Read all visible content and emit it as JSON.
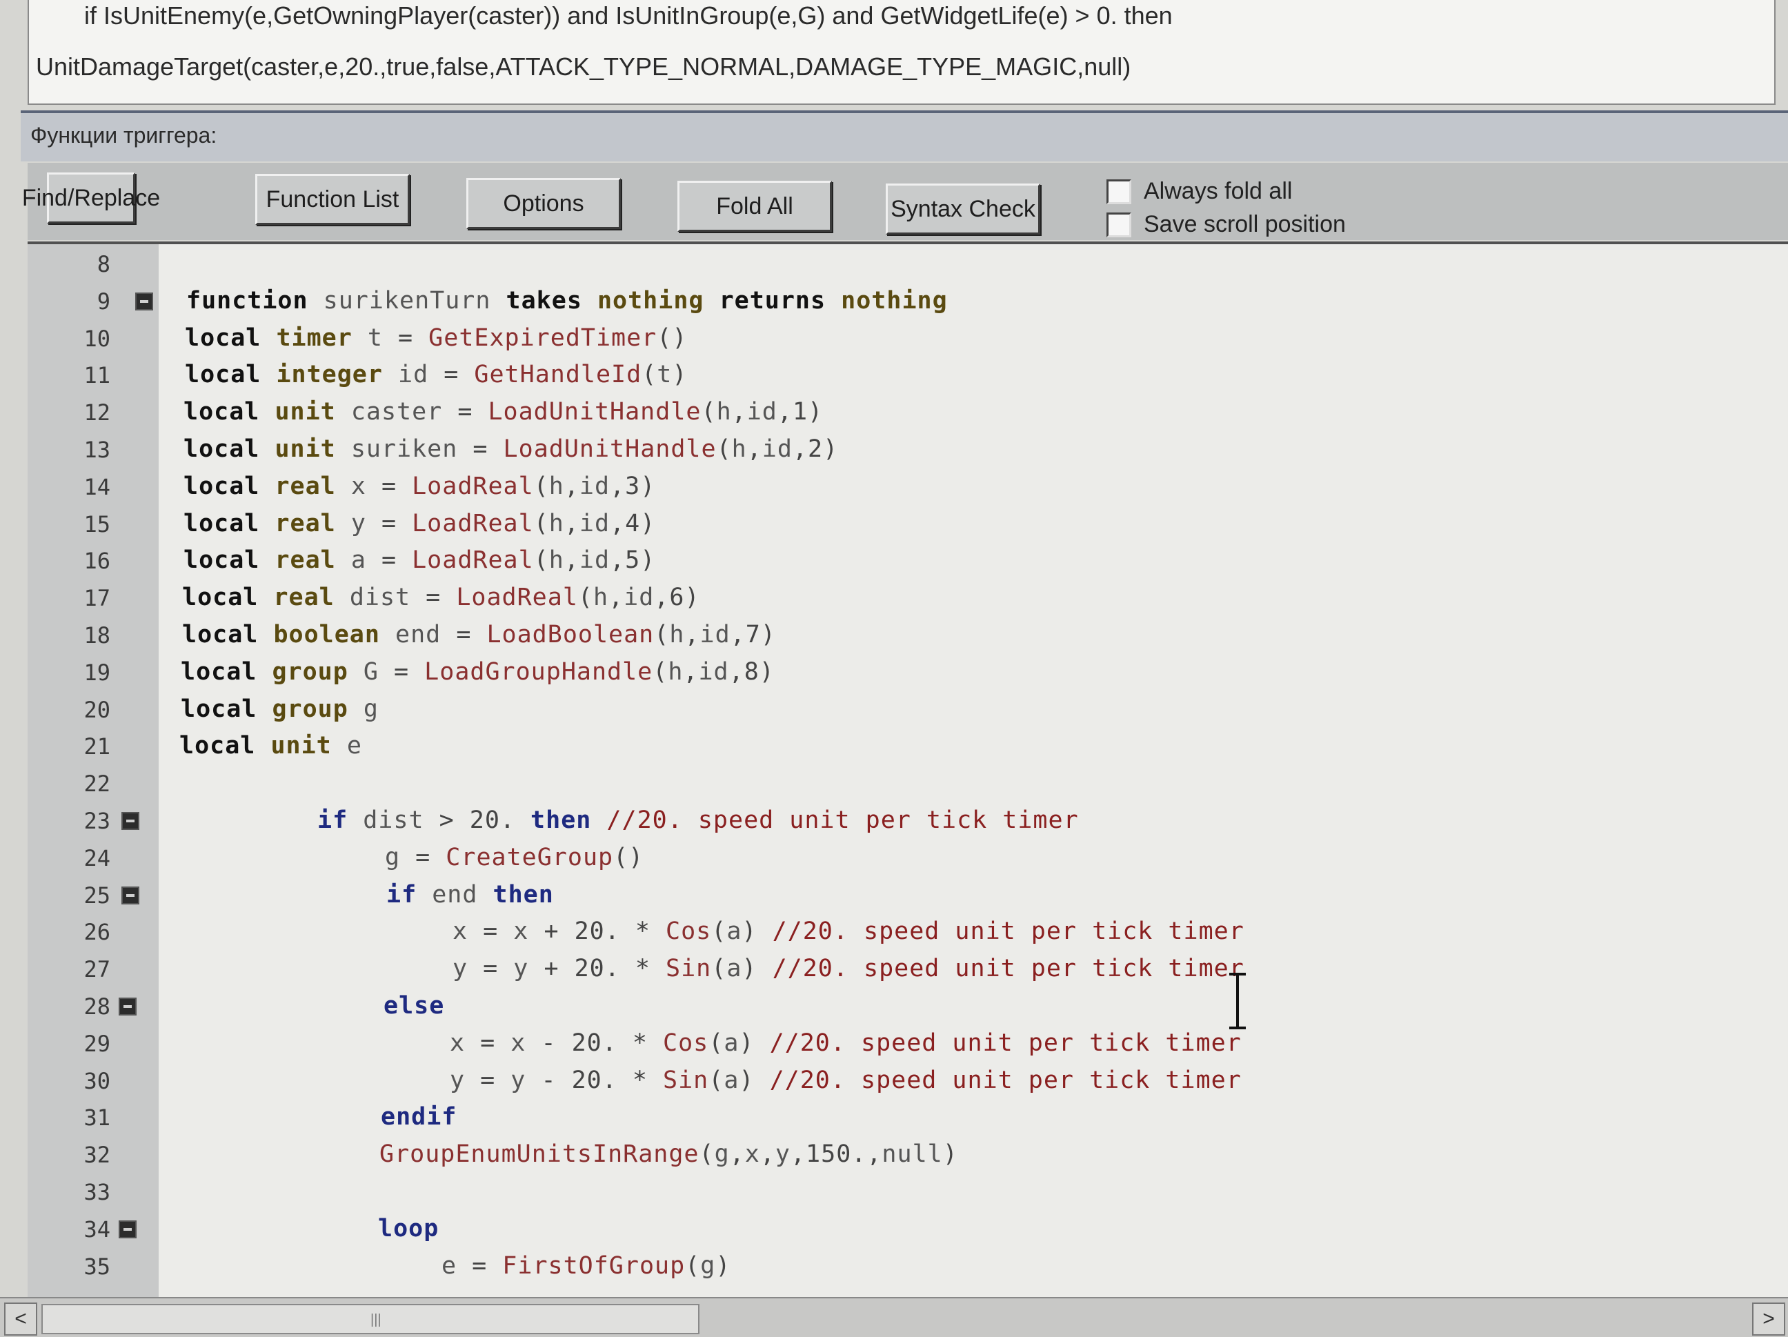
{
  "preview": {
    "line1": "if IsUnitEnemy(e,GetOwningPlayer(caster)) and IsUnitInGroup(e,G) and GetWidgetLife(e) > 0. then",
    "line2": "UnitDamageTarget(caster,e,20.,true,false,ATTACK_TYPE_NORMAL,DAMAGE_TYPE_MAGIC,null)"
  },
  "section": {
    "label": "Функции триггера:"
  },
  "toolbar": {
    "find_replace": "Find/Replace",
    "function_list": "Function List",
    "options": "Options",
    "fold_all": "Fold All",
    "syntax_check": "Syntax Check",
    "always_fold_all": "Always fold all",
    "save_scroll_position": "Save scroll position"
  },
  "editor": {
    "lines": [
      {
        "n": "8",
        "text": ""
      },
      {
        "n": "9",
        "text": "function surikenTurn takes nothing returns nothing",
        "fold": true
      },
      {
        "n": "10",
        "text": "local timer t = GetExpiredTimer()"
      },
      {
        "n": "11",
        "text": "local integer id = GetHandleId(t)"
      },
      {
        "n": "12",
        "text": "local unit caster = LoadUnitHandle(h,id,1)"
      },
      {
        "n": "13",
        "text": "local unit suriken = LoadUnitHandle(h,id,2)"
      },
      {
        "n": "14",
        "text": "local real x = LoadReal(h,id,3)"
      },
      {
        "n": "15",
        "text": "local real y = LoadReal(h,id,4)"
      },
      {
        "n": "16",
        "text": "local real a = LoadReal(h,id,5)"
      },
      {
        "n": "17",
        "text": "local real dist = LoadReal(h,id,6)"
      },
      {
        "n": "18",
        "text": "local boolean end = LoadBoolean(h,id,7)"
      },
      {
        "n": "19",
        "text": "local group G = LoadGroupHandle(h,id,8)"
      },
      {
        "n": "20",
        "text": "local group g"
      },
      {
        "n": "21",
        "text": "local unit e"
      },
      {
        "n": "22",
        "text": ""
      },
      {
        "n": "23",
        "text": "if dist > 20. then //20. speed unit per tick timer",
        "fold": true
      },
      {
        "n": "24",
        "text": "g = CreateGroup()"
      },
      {
        "n": "25",
        "text": "if end then",
        "fold": true
      },
      {
        "n": "26",
        "text": "x = x + 20. * Cos(a) //20. speed unit per tick timer"
      },
      {
        "n": "27",
        "text": "y = y + 20. * Sin(a) //20. speed unit per tick timer"
      },
      {
        "n": "28",
        "text": "else",
        "fold": true
      },
      {
        "n": "29",
        "text": "x = x - 20. * Cos(a) //20. speed unit per tick timer"
      },
      {
        "n": "30",
        "text": "y = y - 20. * Sin(a) //20. speed unit per tick timer"
      },
      {
        "n": "31",
        "text": "endif"
      },
      {
        "n": "32",
        "text": "GroupEnumUnitsInRange(g,x,y,150.,null)"
      },
      {
        "n": "33",
        "text": ""
      },
      {
        "n": "34",
        "text": "loop",
        "fold": true
      },
      {
        "n": "35",
        "text": "e = FirstOfGroup(g)"
      }
    ]
  },
  "scrollbar": {
    "left_arrow": "<",
    "right_arrow": ">",
    "grip": "|||"
  }
}
